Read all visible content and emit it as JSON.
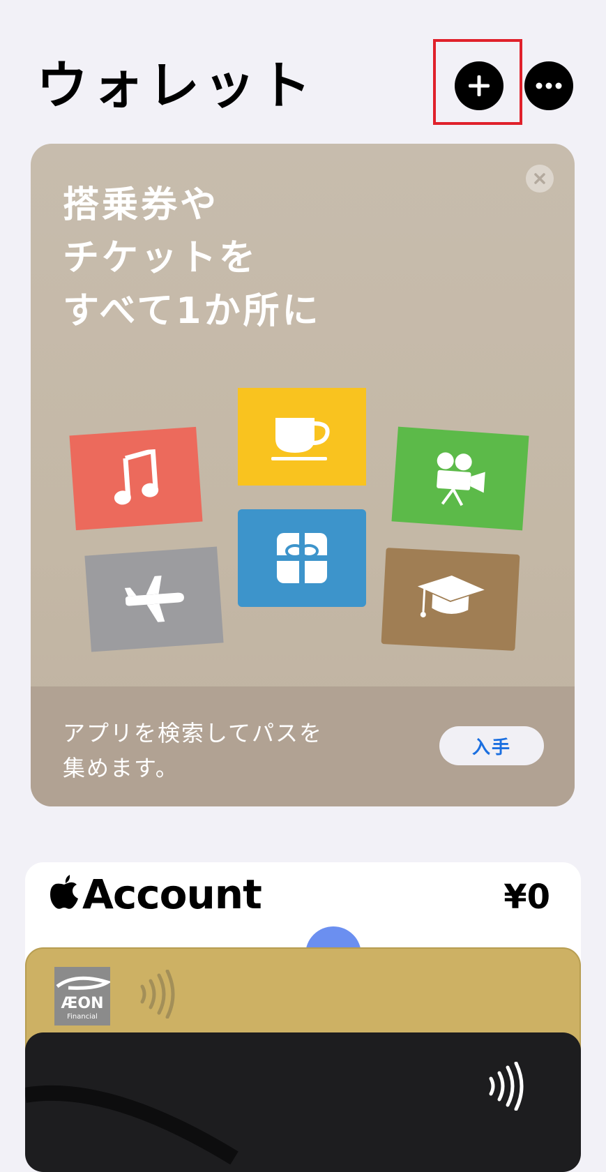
{
  "header": {
    "title": "ウォレット",
    "add_icon": "plus-icon",
    "more_icon": "ellipsis-icon"
  },
  "promo": {
    "headline": [
      "搭乗券や",
      "チケットを",
      "すべて1か所に"
    ],
    "description": [
      "アプリを検索してパスを",
      "集めます。"
    ],
    "get_label": "入手",
    "ticket_icons": [
      "music-note-icon",
      "coffee-cup-icon",
      "movie-camera-icon",
      "airplane-icon",
      "gift-icon",
      "graduation-cap-icon"
    ],
    "colors": {
      "music": "#ec6a5c",
      "cup": "#f9c31f",
      "movie": "#5cba49",
      "plane": "#9c9c9f",
      "gift": "#3d94cb",
      "grad": "#a07e54"
    }
  },
  "cards": {
    "apple_account": {
      "label": "Account",
      "balance": "¥0"
    },
    "aeon": {
      "logo_text": "ÆON",
      "logo_subtext": "Financial"
    }
  },
  "colors": {
    "highlight": "#e0212b",
    "accent": "#1b6fe0"
  }
}
